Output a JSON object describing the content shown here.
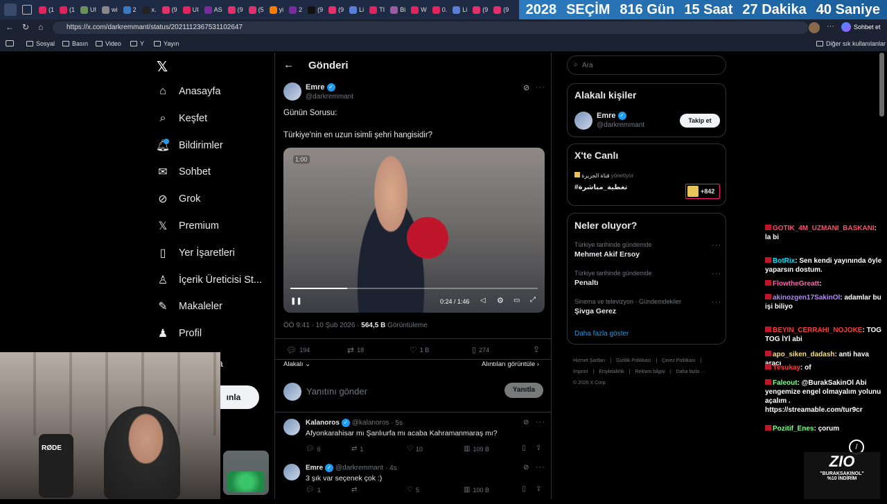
{
  "browser": {
    "tabs": [
      "(1",
      "(1",
      "UI",
      "wi",
      "2",
      "x.",
      "(9",
      "UI",
      "AS",
      "(9",
      "(5",
      "yi",
      "2",
      "(9",
      "(9",
      "Li",
      "TI",
      "Bi",
      "W",
      "0.",
      "Li",
      "(9",
      "(9"
    ],
    "countdown": [
      "2028",
      "SEÇİM",
      "816 Gün",
      "15 Saat",
      "27 Dakika",
      "40 Saniye"
    ],
    "url": "https://x.com/darkremmant/status/2021112367531102647",
    "chat_button": "Sohbet et",
    "bookmarks": [
      "Sosyal",
      "Basın",
      "Video",
      "Y",
      "Yayın"
    ],
    "other_bookmarks": "Diğer sık kullanılanlar"
  },
  "nav": {
    "items": [
      "Anasayfa",
      "Keşfet",
      "Bildirimler",
      "Sohbet",
      "Grok",
      "Premium",
      "Yer İşaretleri",
      "İçerik Üreticisi St...",
      "Makaleler",
      "Profil"
    ],
    "icons": [
      "home-icon",
      "search-icon",
      "bell-icon",
      "mail-icon",
      "grok-icon",
      "x-icon",
      "bookmark-icon",
      "creator-icon",
      "article-icon",
      "profile-icon"
    ],
    "more_label": "a",
    "post_button": "ınla"
  },
  "post": {
    "header": "Gönderi",
    "author_name": "Emre",
    "author_handle": "@darkremmant",
    "text_line1": "Günün Sorusu:",
    "text_line2": "Türkiye'nin en uzun isimli şehri hangisidir?",
    "video_time_badge": "1:00",
    "video_time": "0:24 / 1:46",
    "timestamp": "ÖÖ 9:41 · 10 Şub 2026 ·",
    "views_count": "564,5 B",
    "views_label": "Görüntüleme",
    "stats": {
      "replies": "194",
      "reposts": "18",
      "likes": "1 B",
      "bookmarks": "274"
    },
    "relevant_label": "Alakalı",
    "quotes_label": "Alıntıları görüntüle",
    "reply_placeholder": "Yanıtını gönder",
    "reply_button": "Yanıtla"
  },
  "replies": [
    {
      "name": "Kalanoros",
      "handle": "@kalanoros",
      "time": "· 5s",
      "text": "Afyonkarahisar mı Şanlıurfa mı acaba Kahramanmaraş mı?",
      "stats": [
        "6",
        "1",
        "10",
        "109 B"
      ]
    },
    {
      "name": "Emre",
      "handle": "@darkremmant",
      "time": "· 4s",
      "text": "3 şık var seçenek çok :)",
      "stats": [
        "1",
        "",
        "5",
        "100 B"
      ]
    }
  ],
  "sidebar": {
    "search_placeholder": "Ara",
    "relevant_title": "Alakalı kişiler",
    "relevant_name": "Emre",
    "relevant_handle": "@darkremmant",
    "follow_button": "Takip et",
    "live_title": "X'te Canlı",
    "live_host": "قناة الجزيرة",
    "live_managing": "yönetiyor",
    "live_topic": "#تغطية_مباشرة",
    "live_count": "+842",
    "trends_title": "Neler oluyor?",
    "trends": [
      {
        "category": "Türkiye tarihinde gündemde",
        "name": "Mehmet Akif Ersoy"
      },
      {
        "category": "Türkiye tarihinde gündemde",
        "name": "Penaltı"
      },
      {
        "category": "Sinema ve televizyon · Gündemdekiler",
        "name": "Şivga Gerez"
      }
    ],
    "show_more": "Daha fazla göster",
    "footer_line1": [
      "Hizmet Şartları",
      "|",
      "Gizlilik Politikası",
      "|",
      "Çerez Politikası",
      "|"
    ],
    "footer_line2": [
      "Imprint",
      "|",
      "Erişilebilirlik",
      "|",
      "Reklam bilgisi",
      "|",
      "Daha fazla ···"
    ],
    "copyright": "© 2026 X Corp."
  },
  "chat": [
    {
      "user": "GOTIK_4M_UZMANI_BASKANI",
      "user_color": "#ff4d6d",
      "msg": "la bi"
    },
    {
      "user": "BotRix",
      "user_color": "#00e5ff",
      "msg": "Sen kendi yayınında öyle yaparsın dostum."
    },
    {
      "user": "FlowtheGreatt",
      "user_color": "#ff66aa",
      "msg": ""
    },
    {
      "user": "akinozgen17SakinOl",
      "user_color": "#b388ff",
      "msg": "adamlar bu işi biliyo"
    },
    {
      "user": "BEYIN_CERRAHI_NOJOKE",
      "user_color": "#ff3b3b",
      "msg": "TOG TOG İYİ abi"
    },
    {
      "user": "apo_siken_dadash",
      "user_color": "#ffe066",
      "msg": "anti hava aracı"
    },
    {
      "user": "Yesukay",
      "user_color": "#ff3b3b",
      "msg": "of"
    },
    {
      "user": "Faleout",
      "user_color": "#7cff8a",
      "msg": "@BurakSakinOl Abi yengemize engel olmayalım yolunu açalım . https://streamable.com/tur9cr"
    },
    {
      "user": "Pozitif_Enes",
      "user_color": "#7cff8a",
      "msg": "çorum"
    }
  ],
  "overlay": {
    "logo_text": "ZIO",
    "promo_line1": "\"BURAKSAKINOL\"",
    "promo_line2": "%10 İNDİRİM",
    "mic_brand": "RØDE"
  },
  "colors": {
    "accent": "#1d9bf0",
    "background": "#000000",
    "border": "#2f3336",
    "muted": "#71767b"
  }
}
